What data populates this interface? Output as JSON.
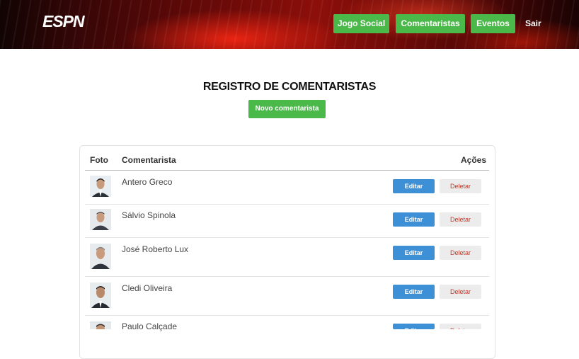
{
  "header": {
    "logo": "ESPN",
    "nav": [
      "Jogo Social",
      "Comentaristas",
      "Eventos"
    ],
    "logout": "Sair"
  },
  "page": {
    "title": "REGISTRO DE COMENTARISTAS",
    "new_button": "Novo comentarista"
  },
  "table": {
    "columns": [
      "Foto",
      "Comentarista",
      "Ações"
    ],
    "rows": [
      {
        "name": "Antero Greco"
      },
      {
        "name": "Sálvio Spinola"
      },
      {
        "name": "José Roberto Lux"
      },
      {
        "name": "Cledi Oliveira"
      },
      {
        "name": "Paulo Calçade"
      }
    ],
    "edit_label": "Editar",
    "delete_label": "Deletar"
  },
  "colors": {
    "green": "#4bb94a",
    "blue": "#3d8fd6",
    "delete_text": "#c0392b",
    "header_red": "#8d0f0a"
  }
}
